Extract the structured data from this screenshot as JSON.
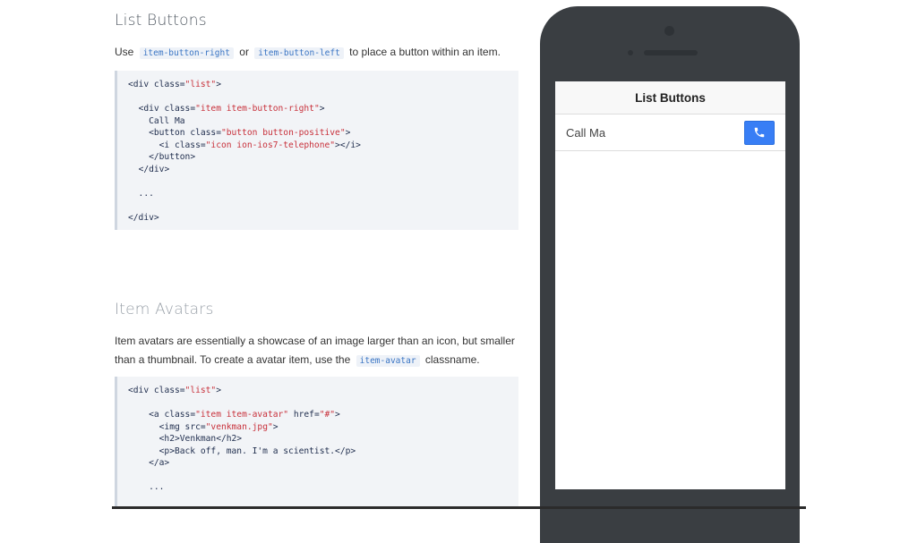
{
  "doc": {
    "list_buttons": {
      "title": "List Buttons",
      "intro_pre": "Use",
      "code_right": "item-button-right",
      "intro_mid": "or",
      "code_left": "item-button-left",
      "intro_post": "to place a button within an item.",
      "code_lines": [
        [
          [
            "tag",
            "<div "
          ],
          [
            "attr",
            "class="
          ],
          [
            "str",
            "\"list\""
          ],
          [
            "tag",
            ">"
          ]
        ],
        [],
        [
          [
            "txt",
            "  "
          ],
          [
            "tag",
            "<div "
          ],
          [
            "attr",
            "class="
          ],
          [
            "str",
            "\"item item-button-right\""
          ],
          [
            "tag",
            ">"
          ]
        ],
        [
          [
            "txt",
            "    Call Ma"
          ]
        ],
        [
          [
            "txt",
            "    "
          ],
          [
            "tag",
            "<button "
          ],
          [
            "attr",
            "class="
          ],
          [
            "str",
            "\"button button-positive\""
          ],
          [
            "tag",
            ">"
          ]
        ],
        [
          [
            "txt",
            "      "
          ],
          [
            "tag",
            "<i "
          ],
          [
            "attr",
            "class="
          ],
          [
            "str",
            "\"icon ion-ios7-telephone\""
          ],
          [
            "tag",
            "></i>"
          ]
        ],
        [
          [
            "txt",
            "    "
          ],
          [
            "tag",
            "</button>"
          ]
        ],
        [
          [
            "txt",
            "  "
          ],
          [
            "tag",
            "</div>"
          ]
        ],
        [],
        [
          [
            "txt",
            "  ..."
          ]
        ],
        [],
        [
          [
            "tag",
            "</div>"
          ]
        ]
      ]
    },
    "item_avatars": {
      "title": "Item Avatars",
      "para_line1": "Item avatars are essentially a showcase of an image larger than an icon, but smaller",
      "para_line2_pre": "than a thumbnail. To create a avatar item, use the",
      "code_avatar": "item-avatar",
      "para_line2_post": "classname.",
      "code_lines": [
        [
          [
            "tag",
            "<div "
          ],
          [
            "attr",
            "class="
          ],
          [
            "str",
            "\"list\""
          ],
          [
            "tag",
            ">"
          ]
        ],
        [],
        [
          [
            "txt",
            "    "
          ],
          [
            "tag",
            "<a "
          ],
          [
            "attr",
            "class="
          ],
          [
            "str",
            "\"item item-avatar\""
          ],
          [
            "attr",
            " href="
          ],
          [
            "str",
            "\"#\""
          ],
          [
            "tag",
            ">"
          ]
        ],
        [
          [
            "txt",
            "      "
          ],
          [
            "tag",
            "<img "
          ],
          [
            "attr",
            "src="
          ],
          [
            "str",
            "\"venkman.jpg\""
          ],
          [
            "tag",
            ">"
          ]
        ],
        [
          [
            "txt",
            "      "
          ],
          [
            "tag",
            "<h2>"
          ],
          [
            "txt",
            "Venkman"
          ],
          [
            "tag",
            "</h2>"
          ]
        ],
        [
          [
            "txt",
            "      "
          ],
          [
            "tag",
            "<p>"
          ],
          [
            "txt",
            "Back off, man. I'm a scientist."
          ],
          [
            "tag",
            "</p>"
          ]
        ],
        [
          [
            "txt",
            "    "
          ],
          [
            "tag",
            "</a>"
          ]
        ],
        [],
        [
          [
            "txt",
            "    ..."
          ]
        ]
      ]
    }
  },
  "phone": {
    "nav_title": "List Buttons",
    "item_label": "Call Ma",
    "button_icon": "telephone-icon",
    "accent_color": "#387ef5"
  }
}
